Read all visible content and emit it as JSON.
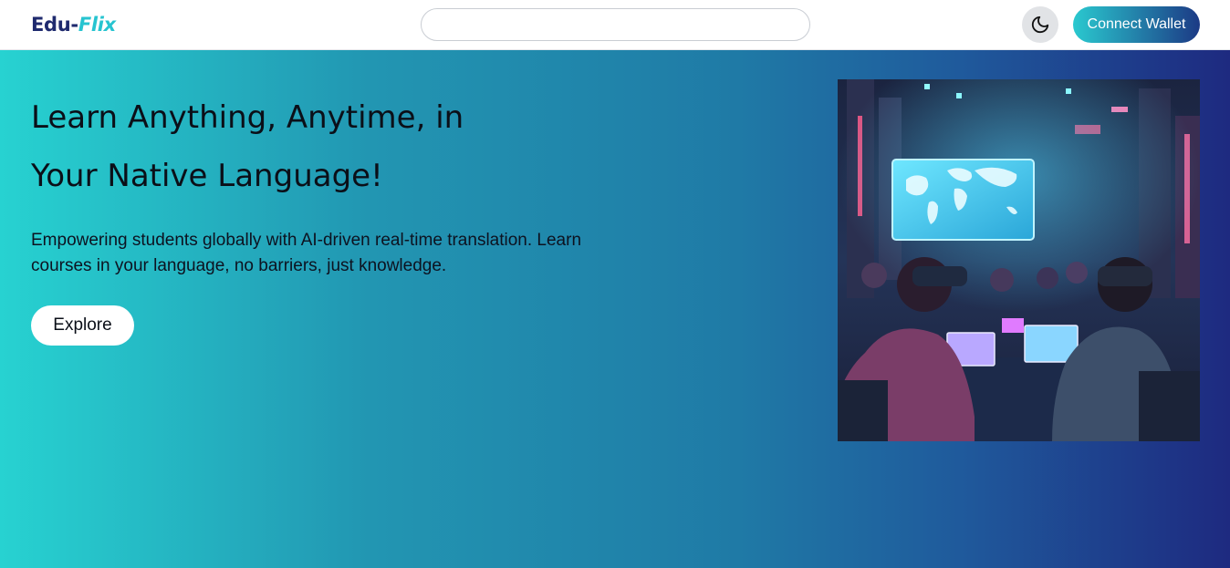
{
  "navbar": {
    "logo_part1": "Edu-",
    "logo_part2": "Flix",
    "search_placeholder": "",
    "theme_toggle_icon": "moon-icon",
    "connect_wallet_label": "Connect Wallet"
  },
  "hero": {
    "headline_line1": "Learn Anything, Anytime, in",
    "headline_line2": "Your Native Language!",
    "description": "Empowering students globally with AI-driven real-time translation. Learn courses in your language, no barriers, just knowledge.",
    "explore_label": "Explore",
    "image_subject": "students-in-vr-headsets-with-laptops-and-world-map-screen"
  },
  "colors": {
    "brand_dark": "#1f2a6e",
    "brand_accent": "#27c4d0",
    "gradient_start": "#27d2d1",
    "gradient_end": "#1e2a80"
  }
}
